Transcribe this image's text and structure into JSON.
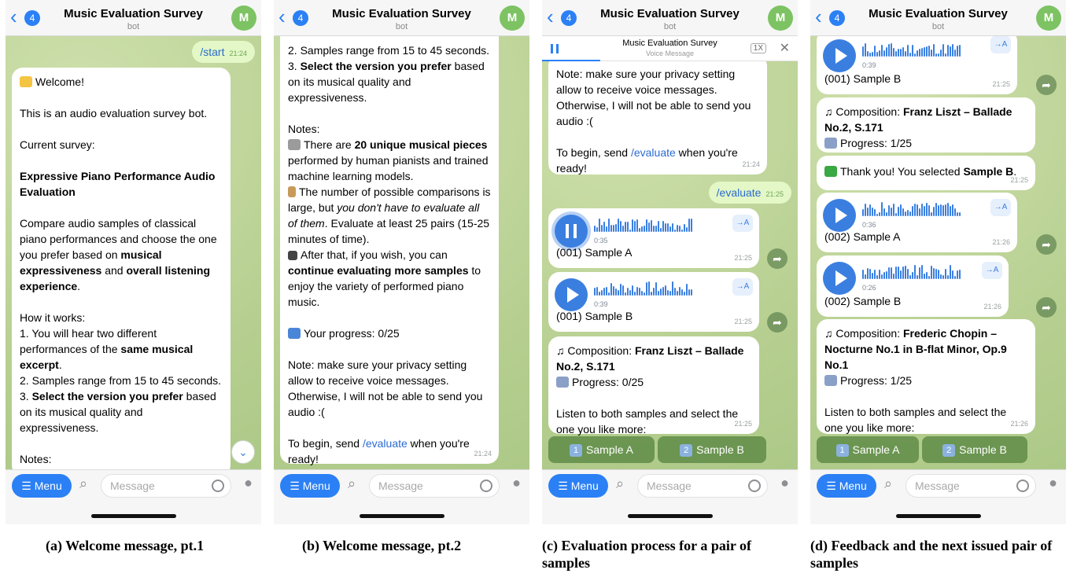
{
  "header": {
    "back_count": "4",
    "title": "Music Evaluation Survey",
    "subtitle": "bot",
    "avatar_letter": "M"
  },
  "input_bar": {
    "menu_label": "Menu",
    "placeholder": "Message"
  },
  "panel1": {
    "start_cmd": "/start",
    "start_time": "21:24",
    "welcome": "Welcome!",
    "intro": "This is an audio evaluation survey bot.",
    "current_survey": "Current survey:",
    "survey_name": "Expressive Piano Performance Audio Evaluation",
    "compare_a": "Compare audio samples of classical piano performances and choose the one you prefer based on ",
    "compare_b1": "musical expressiveness",
    "compare_c": " and ",
    "compare_b2": "overall listening experience",
    "compare_d": ".",
    "how": "How it works:",
    "step1a": "1. You will hear two different performances of the ",
    "step1b": "same musical excerpt",
    "step1c": ".",
    "step2": "2. Samples range from 15 to 45 seconds.",
    "step3a": "3. ",
    "step3b": "Select the version you prefer",
    "step3c": " based on its musical quality and expressiveness.",
    "notes": "Notes:"
  },
  "panel2": {
    "top_a": "2. Samples range from 15 to 45 seconds.",
    "top_b": "3. ",
    "top_c": "Select the version you prefer",
    "top_d": " based on its musical quality and expressiveness.",
    "notes": "Notes:",
    "n1a": "There are ",
    "n1b": "20 unique musical pieces",
    "n1c": " performed by human pianists and trained machine learning models.",
    "n2a": "The number of possible comparisons is large, but ",
    "n2b": "you don't have to evaluate all of them",
    "n2c": ". Evaluate at least 25 pairs (15-25 minutes of time).",
    "n3a": "After that, if you wish, you can ",
    "n3b": "continue evaluating more samples",
    "n3c": " to enjoy the variety of performed piano music.",
    "progress": "Your progress: 0/25",
    "privacy": "Note: make sure your privacy setting allow to receive voice messages. Otherwise, I will not be able to send you audio :(",
    "begin_a": "To begin, send ",
    "begin_link": "/evaluate",
    "begin_b": " when you're ready!",
    "time": "21:24"
  },
  "panel3": {
    "player_title": "Music Evaluation Survey",
    "player_sub": "Voice Message",
    "player_speed": "1X",
    "privacy": "Note: make sure your privacy setting allow to receive voice messages. Otherwise, I will not be able to send you audio :(",
    "begin_a": "To begin, send ",
    "begin_link": "/evaluate",
    "begin_b": " when you're ready!",
    "time1": "21:24",
    "eval_cmd": "/evaluate",
    "eval_time": "21:25",
    "voiceA": {
      "dur": "0:35",
      "label": "(001) Sample A",
      "time": "21:25"
    },
    "voiceB": {
      "dur": "0:39",
      "label": "(001) Sample B",
      "time": "21:25"
    },
    "comp_a": "Composition: ",
    "comp_b": "Franz Liszt – Ballade No.2, S.171",
    "progress": "Progress: 0/25",
    "listen": "Listen to both samples and select the one you like more:",
    "time2": "21:25",
    "btnA_num": "1",
    "btnA": "Sample A",
    "btnB_num": "2",
    "btnB": "Sample B"
  },
  "panel4": {
    "voice1": {
      "dur": "0:39",
      "label": "(001) Sample B",
      "time": "21:25"
    },
    "comp1_a": "Composition: ",
    "comp1_b": "Franz Liszt – Ballade No.2, S.171",
    "progress1": "Progress: 1/25",
    "thanks_a": "Thank you! You selected ",
    "thanks_b": "Sample B",
    "thanks_c": ".",
    "thanks_time": "21:25",
    "voice2": {
      "dur": "0:36",
      "label": "(002) Sample A",
      "time": "21:26"
    },
    "voice3": {
      "dur": "0:26",
      "label": "(002) Sample B",
      "time": "21:26"
    },
    "comp2_a": "Composition: ",
    "comp2_b": "Frederic Chopin – Nocturne No.1 in B-flat Minor, Op.9 No.1",
    "progress2": "Progress: 1/25",
    "listen": "Listen to both samples and select the one you like more:",
    "time2": "21:26",
    "btnA_num": "1",
    "btnA": "Sample A",
    "btnB_num": "2",
    "btnB": "Sample B"
  },
  "captions": {
    "a": "(a) Welcome message, pt.1",
    "b": "(b) Welcome message, pt.2",
    "c": "(c) Evaluation process for a pair of samples",
    "d": "(d) Feedback and the next issued pair of samples"
  },
  "colors": {
    "accent": "#2b80f5",
    "avatar": "#7dc363",
    "outgoing": "#e3f7c7",
    "keyboard": "#5f8c46"
  }
}
